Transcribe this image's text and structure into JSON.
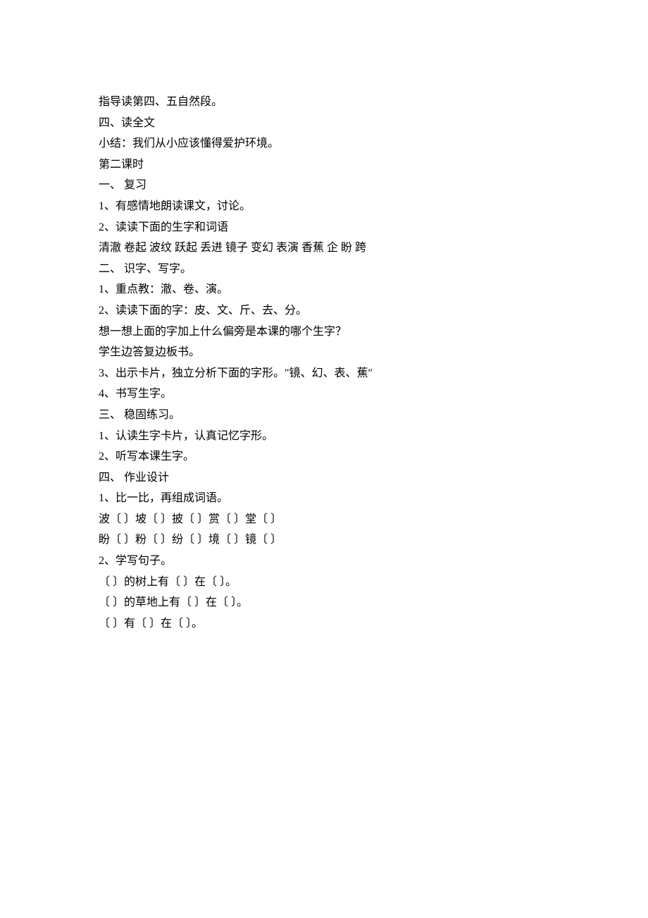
{
  "lines": [
    "指导读第四、五自然段。",
    "四、读全文",
    "小结：我们从小应该懂得爱护环境。",
    "第二课时",
    "一、 复习",
    "1、有感情地朗读课文，讨论。",
    "2、读读下面的生字和词语",
    "清澈 卷起 波纹 跃起 丢进 镜子 变幻 表演 香蕉 企 盼 跨",
    "二、 识字、写字。",
    "1、重点教：澈、卷、演。",
    "2、读读下面的字：皮、文、斤、去、分。",
    "想一想上面的字加上什么偏旁是本课的哪个生字？",
    "学生边答复边板书。",
    "3、出示卡片，独立分析下面的字形。\"镜、幻、表、蕉″",
    "4、书写生字。",
    "三、 稳固练习。",
    "1、认读生字卡片，认真记忆字形。",
    "2、听写本课生字。",
    "四、 作业设计",
    "1、比一比，再组成词语。",
    "波〔 〕坡〔 〕披〔 〕赏〔 〕堂〔 〕",
    "盼〔 〕粉〔 〕纷〔 〕境〔 〕镜〔 〕",
    "2、学写句子。",
    "〔 〕的树上有〔 〕在〔 〕。",
    "〔 〕的草地上有〔 〕在〔 〕。",
    "〔 〕有〔 〕在〔 〕。"
  ]
}
